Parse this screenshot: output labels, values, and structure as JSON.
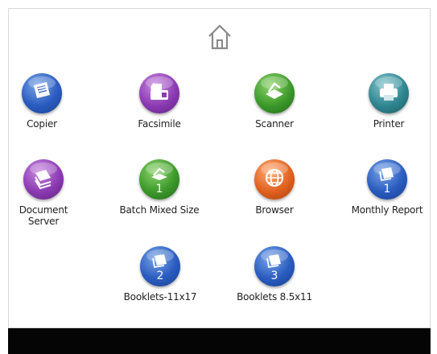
{
  "colors": {
    "screen_bg": "#ffffff",
    "bottom_bar": "#050505",
    "copier": "#2a5cc0",
    "facsimile": "#8c3bb3",
    "scanner": "#3c9a2a",
    "printer": "#2f8690",
    "document_server": "#8c3bb3",
    "batch_mixed_size": "#3c9a2a",
    "browser": "#e1611f",
    "monthly_report": "#2a5cc0",
    "booklets_11x17": "#2a5cc0",
    "booklets_8_5x11": "#2a5cc0"
  },
  "header": {
    "home_icon": "home-icon"
  },
  "apps": {
    "copier": {
      "label": "Copier",
      "icon": "copier-icon"
    },
    "facsimile": {
      "label": "Facsimile",
      "icon": "fax-icon"
    },
    "scanner": {
      "label": "Scanner",
      "icon": "scanner-icon"
    },
    "printer": {
      "label": "Printer",
      "icon": "printer-icon"
    },
    "document_server": {
      "label_line1": "Document",
      "label_line2": "Server",
      "icon": "document-server-icon"
    },
    "batch_mixed_size": {
      "label": "Batch Mixed Size",
      "badge": "1",
      "icon": "scanner-icon"
    },
    "browser": {
      "label": "Browser",
      "icon": "globe-icon"
    },
    "monthly_report": {
      "label": "Monthly Report",
      "badge": "1",
      "icon": "document-stack-icon"
    },
    "booklets_11x17": {
      "label": "Booklets-11x17",
      "badge": "2",
      "icon": "document-stack-icon"
    },
    "booklets_8_5x11": {
      "label": "Booklets 8.5x11",
      "badge": "3",
      "icon": "document-stack-icon"
    }
  }
}
